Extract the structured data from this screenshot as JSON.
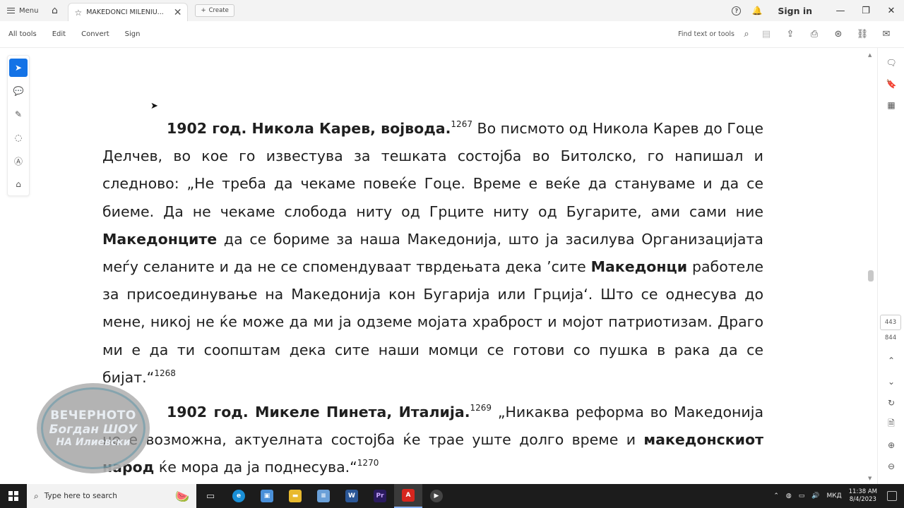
{
  "titlebar": {
    "menu_label": "Menu",
    "tab_title": "MAKEDONCI MILENIU...",
    "create_label": "Create",
    "signin_label": "Sign in"
  },
  "toolbar": {
    "all_tools": "All tools",
    "edit": "Edit",
    "convert": "Convert",
    "sign": "Sign",
    "find_placeholder": "Find text or tools"
  },
  "page_nav": {
    "current_page": "443",
    "total_pages": "844"
  },
  "document": {
    "p1": {
      "lead": "1902 год. Никола Карев, војвода.",
      "note1": "1267",
      "t1": " Во писмото од Никола Карев до Гоце Делчев, во кое го известува за тешката состојба во Битолско, го напишал и следново: „Не треба да чекаме повеќе Гоце. Време е веќе да стануваме и да се биеме. Да не чекаме слобода ниту од Грците ниту од Бугарите, ами сами ние ",
      "b1": "Македонците",
      "t2": " да се бориме за наша Македонија, што ја засилува Организацијата меѓу селаните и да не се спомендуваат тврдењата дека ’сите ",
      "b2": "Македонци",
      "t3": " работеле за присоединување на Македонија кон Бугарија или Грција‘. Што се однесува до мене, никој не ќе може да ми ја одземе мојата храброст и мојот патриотизам. Драго ми е да ти соопштам дека сите наши момци се готови со пушка в рака да се бијат.“",
      "note2": "1268"
    },
    "p2": {
      "lead": "1902 год. Микеле Пинета, Италија.",
      "note1": "1269",
      "t1": " „Никаква реформа во Македонија не е возможна, актуелната состојба ќе трае уште долго време и ",
      "b1": "македонскиот народ",
      "t2": " ќе мора да ја поднесува.“",
      "note2": "1270"
    }
  },
  "watermark": {
    "line1": "ВЕЧЕРНОТО",
    "line2": "Богдан ШОУ",
    "line3": "НА Илиевски"
  },
  "taskbar": {
    "search_placeholder": "Type here to search",
    "lang": "МКД",
    "time": "11:38 AM",
    "date": "8/4/2023"
  },
  "icons": {
    "select": "cursor-arrow-icon",
    "comment": "comment-icon",
    "draw": "pen-icon",
    "lasso": "lasso-icon",
    "textbox": "text-box-icon",
    "stamp": "stamp-icon"
  }
}
